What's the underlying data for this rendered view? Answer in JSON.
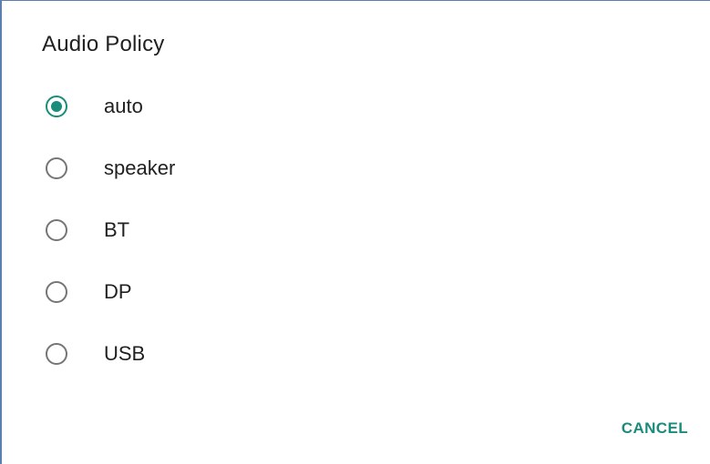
{
  "dialog": {
    "title": "Audio Policy",
    "options": [
      {
        "label": "auto",
        "checked": true
      },
      {
        "label": "speaker",
        "checked": false
      },
      {
        "label": "BT",
        "checked": false
      },
      {
        "label": "DP",
        "checked": false
      },
      {
        "label": "USB",
        "checked": false
      }
    ],
    "cancel_label": "CANCEL"
  },
  "colors": {
    "accent": "#1a8c7c",
    "text": "#212121",
    "radio_unchecked": "#757575",
    "frame_border": "#5b7fb0"
  }
}
